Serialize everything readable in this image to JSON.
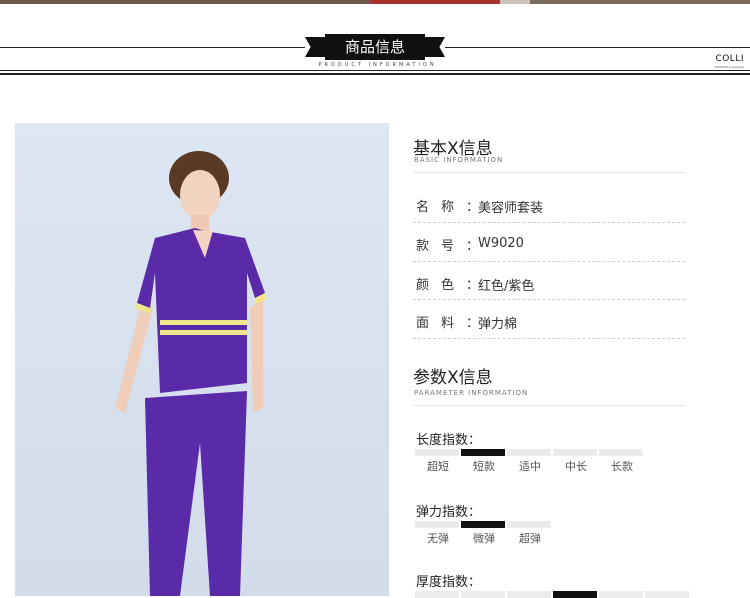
{
  "header": {
    "title": "商品信息",
    "subtitle": "PRODUCT INFORMATION",
    "brand": "COLLI",
    "brand_tagline": "FASHION & CASUAL"
  },
  "colors": {
    "accent": "#111111",
    "uniform_purple": "#5a2aa8",
    "trim_yellow": "#f1e48c"
  },
  "product_image": {
    "icon": "product-photo-model-icon"
  },
  "basic_info": {
    "title": "基本X信息",
    "subtitle": "BASIC INFORMATION",
    "rows": [
      {
        "label": "名称：",
        "value": "美容师套装"
      },
      {
        "label": "款号：",
        "value": "W9020"
      },
      {
        "label": "颜色：",
        "value": "红色/紫色"
      },
      {
        "label": "面料：",
        "value": "弹力棉"
      }
    ]
  },
  "param_info": {
    "title": "参数X信息",
    "subtitle": "PARAMETER INFORMATION",
    "length": {
      "label": "长度指数：",
      "options": [
        "超短",
        "短款",
        "适中",
        "中长",
        "长款"
      ],
      "selected": "短款"
    },
    "stretch": {
      "label": "弹力指数：",
      "options": [
        "无弹",
        "微弹",
        "超弹"
      ],
      "selected": "微弹"
    },
    "thickness": {
      "label": "厚度指数："
    }
  }
}
